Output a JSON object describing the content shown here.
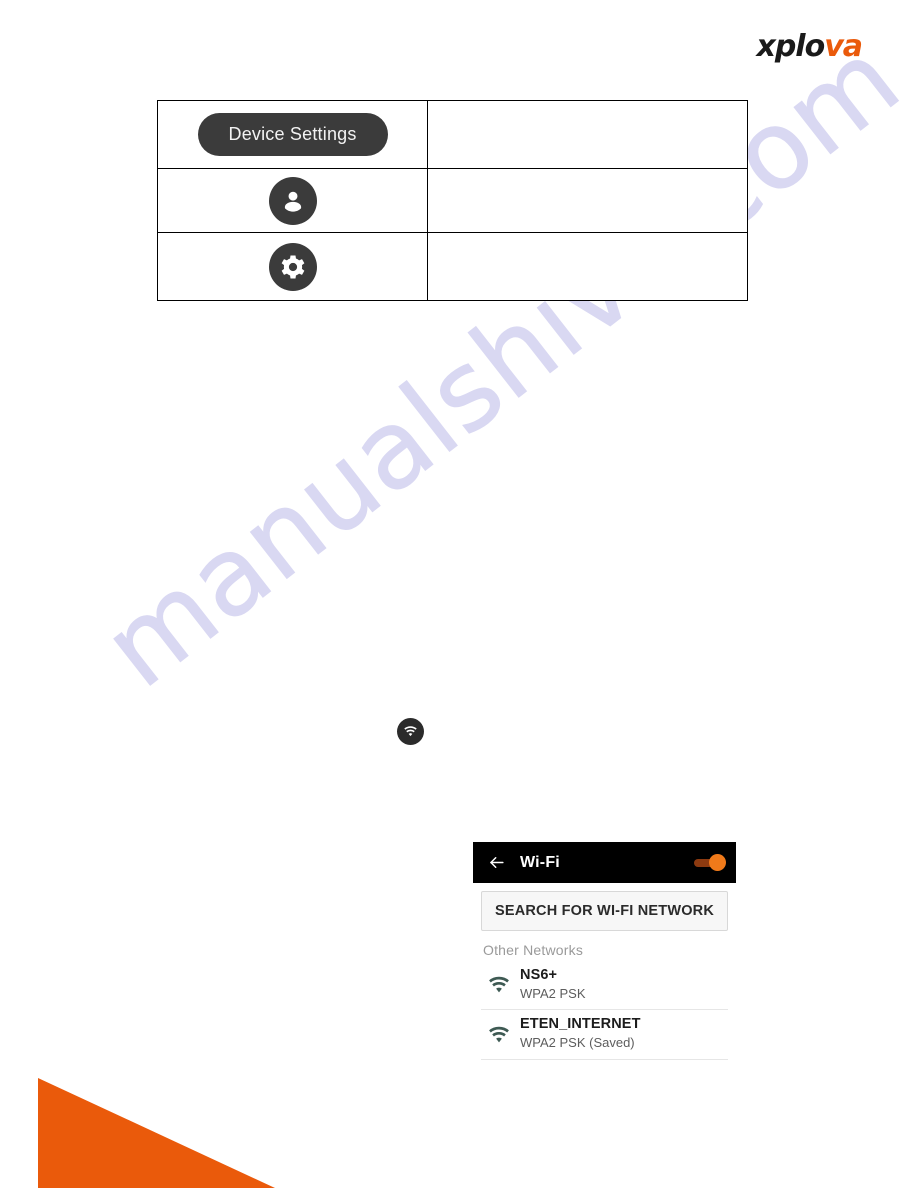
{
  "brand": {
    "name_dark": "xplo",
    "name_accent": "va",
    "accent_color": "#ea5a0b"
  },
  "watermark": {
    "text": "manualshive.com",
    "color": "#d9d8f2"
  },
  "spec_table": {
    "rows": [
      {
        "icon_name": "device-settings-pill",
        "label": "Device Settings",
        "description": ""
      },
      {
        "icon_name": "account-icon",
        "label": "",
        "description": ""
      },
      {
        "icon_name": "gear-icon",
        "label": "",
        "description": ""
      }
    ]
  },
  "wifi_badge": {
    "icon_name": "wifi-icon"
  },
  "wifi_panel": {
    "header": {
      "back_icon": "back-arrow-icon",
      "title": "Wi-Fi",
      "toggle_state": "on",
      "toggle_color": "#f07a1a"
    },
    "search_button_label": "SEARCH FOR WI-FI NETWORK",
    "section_label": "Other Networks",
    "networks": [
      {
        "ssid": "NS6+",
        "security": "WPA2 PSK",
        "icon_name": "wifi-signal-icon"
      },
      {
        "ssid": "ETEN_INTERNET",
        "security": "WPA2 PSK (Saved)",
        "icon_name": "wifi-signal-icon"
      }
    ]
  },
  "decor": {
    "corner_triangle_color": "#ea5a0b"
  }
}
